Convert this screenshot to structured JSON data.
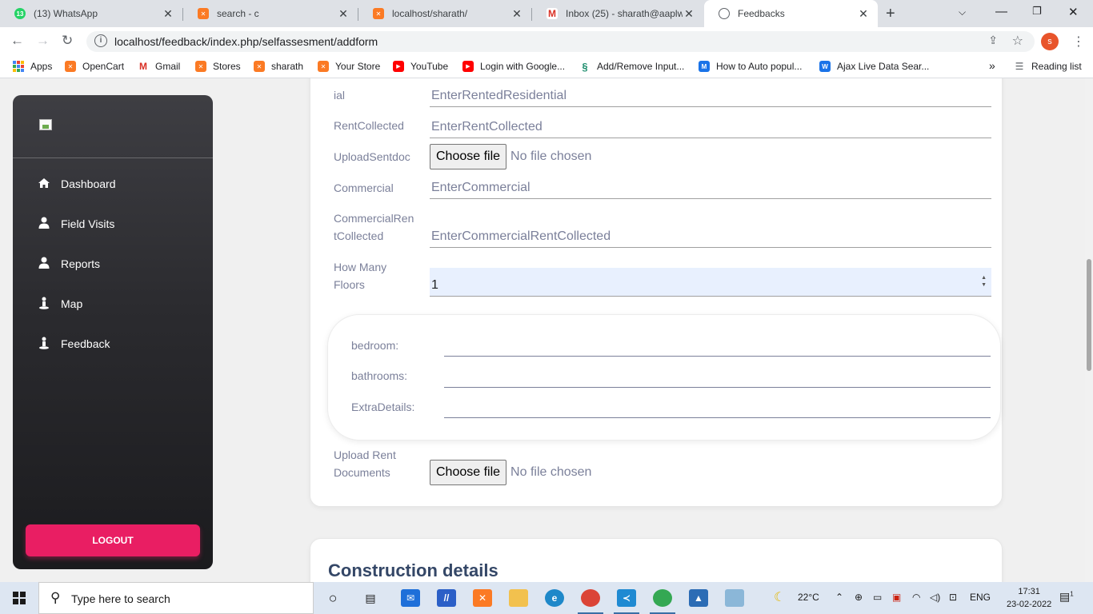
{
  "browser": {
    "tabs": [
      {
        "title": "(13) WhatsApp",
        "favicon": "whatsapp-icon",
        "badge": "13",
        "color": "#25d366"
      },
      {
        "title": "search - c",
        "favicon": "xampp-icon",
        "color": "#fb7a24"
      },
      {
        "title": "localhost/sharath/",
        "favicon": "xampp-icon",
        "color": "#fb7a24"
      },
      {
        "title": "Inbox (25) - sharath@aaplwe",
        "favicon": "gmail-icon",
        "color": "#d93025"
      },
      {
        "title": "Feedbacks",
        "favicon": "globe-icon",
        "color": "#5f6368",
        "active": true
      }
    ],
    "url": "localhost/feedback/index.php/selfassesment/addform",
    "profile_initial": "s",
    "bookmarks": [
      {
        "label": "Apps",
        "icon": "apps-grid-icon"
      },
      {
        "label": "OpenCart",
        "icon": "xampp-icon"
      },
      {
        "label": "Gmail",
        "icon": "gmail-icon"
      },
      {
        "label": "Stores",
        "icon": "xampp-icon"
      },
      {
        "label": "sharath",
        "icon": "xampp-icon"
      },
      {
        "label": "Your Store",
        "icon": "xampp-icon"
      },
      {
        "label": "YouTube",
        "icon": "youtube-icon"
      },
      {
        "label": "Login with Google...",
        "icon": "youtube-icon"
      },
      {
        "label": "Add/Remove Input...",
        "icon": "s-logo-icon"
      },
      {
        "label": "How to Auto popul...",
        "icon": "m-logo-icon"
      },
      {
        "label": "Ajax Live Data Sear...",
        "icon": "w-logo-icon"
      }
    ],
    "more_bookmarks": "»",
    "reading_list": "Reading list"
  },
  "sidebar": {
    "items": [
      {
        "label": "Dashboard",
        "icon": "home-icon"
      },
      {
        "label": "Field Visits",
        "icon": "user-icon"
      },
      {
        "label": "Reports",
        "icon": "user-icon"
      },
      {
        "label": "Map",
        "icon": "person-pin-icon"
      },
      {
        "label": "Feedback",
        "icon": "person-pin-icon"
      }
    ],
    "logout_label": "LOGOUT"
  },
  "form": {
    "fields": [
      {
        "label": "ial",
        "placeholder": "EnterRentedResidential"
      },
      {
        "label": "RentCollected",
        "placeholder": "EnterRentCollected"
      },
      {
        "label": "UploadSentdoc",
        "button": "Choose file",
        "status": "No file chosen"
      },
      {
        "label": "Commercial",
        "placeholder": "EnterCommercial"
      },
      {
        "label_line1": "CommercialRen",
        "label_line2": "tCollected",
        "placeholder": "EnterCommercialRentCollected"
      },
      {
        "label_line1": "How Many",
        "label_line2": "Floors",
        "value": "1"
      }
    ],
    "floor": {
      "bedroom_label": "bedroom:",
      "bathrooms_label": "bathrooms:",
      "extra_label": "ExtraDetails:"
    },
    "upload_rent": {
      "label_line1": "Upload Rent",
      "label_line2": "Documents",
      "button": "Choose file",
      "status": "No file chosen"
    }
  },
  "construction": {
    "title": "Construction details"
  },
  "taskbar": {
    "search_placeholder": "Type here to search",
    "weather": "22°C",
    "language": "ENG",
    "time": "17:31",
    "date": "23-02-2022",
    "notification_count": "1"
  }
}
